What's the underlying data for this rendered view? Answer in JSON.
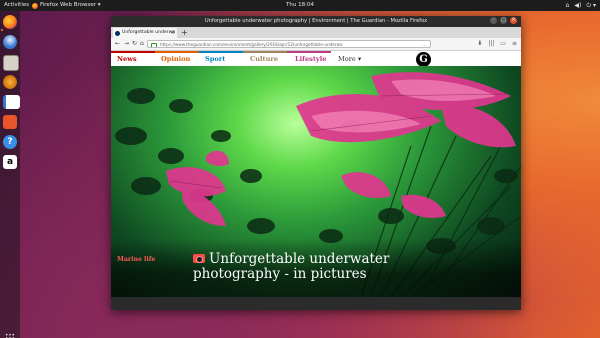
{
  "topbar": {
    "activities": "Activities",
    "app_menu": "Firefox Web Browser ▾",
    "clock": "Thu 18:04",
    "tray": [
      "⌂",
      "◀)",
      "⏻ ▾"
    ]
  },
  "dock": {
    "items": [
      "firefox",
      "thunderbird",
      "files",
      "rhythmbox",
      "libreoffice-writer",
      "ubuntu-software",
      "help",
      "amazon"
    ],
    "help_glyph": "?",
    "amazon_glyph": "a"
  },
  "window": {
    "title": "Unforgettable underwater photography | Environment | The Guardian - Mozilla Firefox",
    "tab_title": "Unforgettable underwa",
    "tab_close": "×",
    "newtab": "+",
    "url": "https://www.theguardian.com/environment/gallery/2018/apr/12/unforgettable-underwa",
    "url_more": "…",
    "nav": {
      "back": "←",
      "forward": "→",
      "reload": "↻",
      "home": "⌂"
    },
    "tools": [
      "⬇",
      "|||",
      "▭",
      "≡"
    ]
  },
  "guardian": {
    "nav": {
      "news": "News",
      "opinion": "Opinion",
      "sport": "Sport",
      "culture": "Culture",
      "lifestyle": "Lifestyle",
      "more": "More ▾"
    },
    "logo": "G",
    "colors": {
      "news": "#c70000",
      "opinion": "#e05e00",
      "sport": "#0084c6",
      "culture": "#a1845c",
      "lifestyle": "#bb3b80"
    },
    "kicker": "Marine life",
    "headline": "Unforgettable underwater photography - in pictures"
  }
}
